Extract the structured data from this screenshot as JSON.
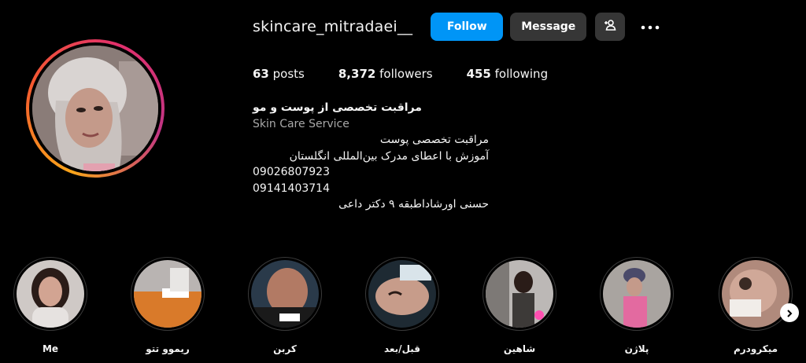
{
  "profile": {
    "username": "skincare_mitradaei__",
    "follow_label": "Follow",
    "message_label": "Message",
    "add_user_icon": "add-person-icon",
    "more_icon": "more-horizontal-icon",
    "stats": {
      "posts_count": "63",
      "posts_label": "posts",
      "followers_count": "8,372",
      "followers_label": "followers",
      "following_count": "455",
      "following_label": "following"
    },
    "bio": {
      "name": "مراقبت تخصصی از پوست و مو",
      "category": "Skin Care Service",
      "lines": [
        "مراقبت تخصصی پوست",
        "آموزش با اعطای مدرک بین‌المللی انگلستان",
        "09026807923",
        "09141403714",
        "حسنی اورشاداطبقه ۹ دکتر داعی"
      ]
    }
  },
  "highlights": [
    {
      "label": "Me"
    },
    {
      "label": "ریموو تتو"
    },
    {
      "label": "کربن"
    },
    {
      "label": "قبل/بعد"
    },
    {
      "label": "شاهین"
    },
    {
      "label": "پلاژن"
    },
    {
      "label": "میکرودرم"
    }
  ],
  "colors": {
    "background": "#000000",
    "follow_button": "#0095f6",
    "secondary_button": "#363636",
    "muted_text": "#a8a8a8"
  }
}
